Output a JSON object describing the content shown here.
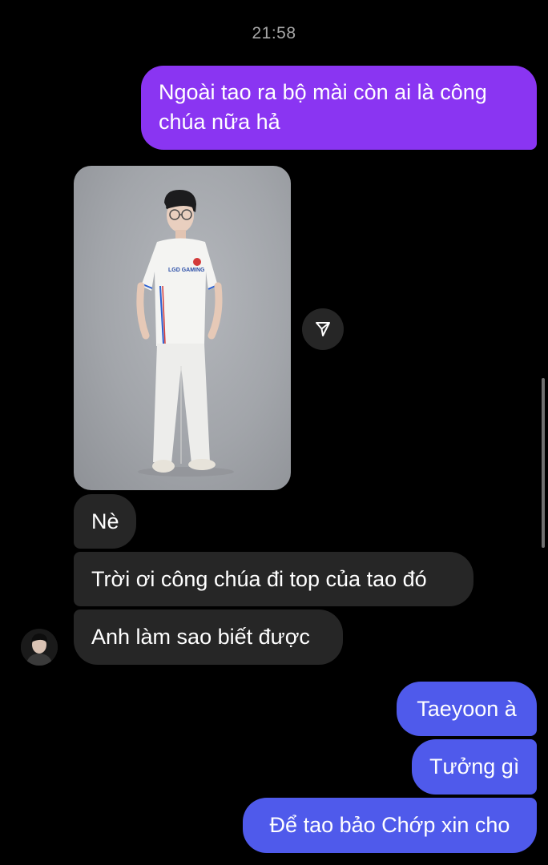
{
  "timestamp": "21:58",
  "messages": {
    "outgoing_1": "Ngoài tao ra bộ mài còn ai là công chúa nữa hả",
    "incoming": [
      "Nè",
      "Trời ơi công chúa đi top của tao đó",
      "Anh làm sao biết được"
    ],
    "outgoing": [
      "Taeyoon à",
      "Tưởng gì",
      "Để tao bảo Chớp xin cho"
    ]
  },
  "photo": {
    "shirt_text": "LGD GAMING"
  },
  "icons": {
    "share": "share-icon",
    "avatar": "avatar"
  },
  "colors": {
    "background": "#000000",
    "outgoing_purple": "#8a35f2",
    "outgoing_blue": "#4f5aeb",
    "incoming_gray": "#262626",
    "timestamp": "#a7a7a7"
  }
}
